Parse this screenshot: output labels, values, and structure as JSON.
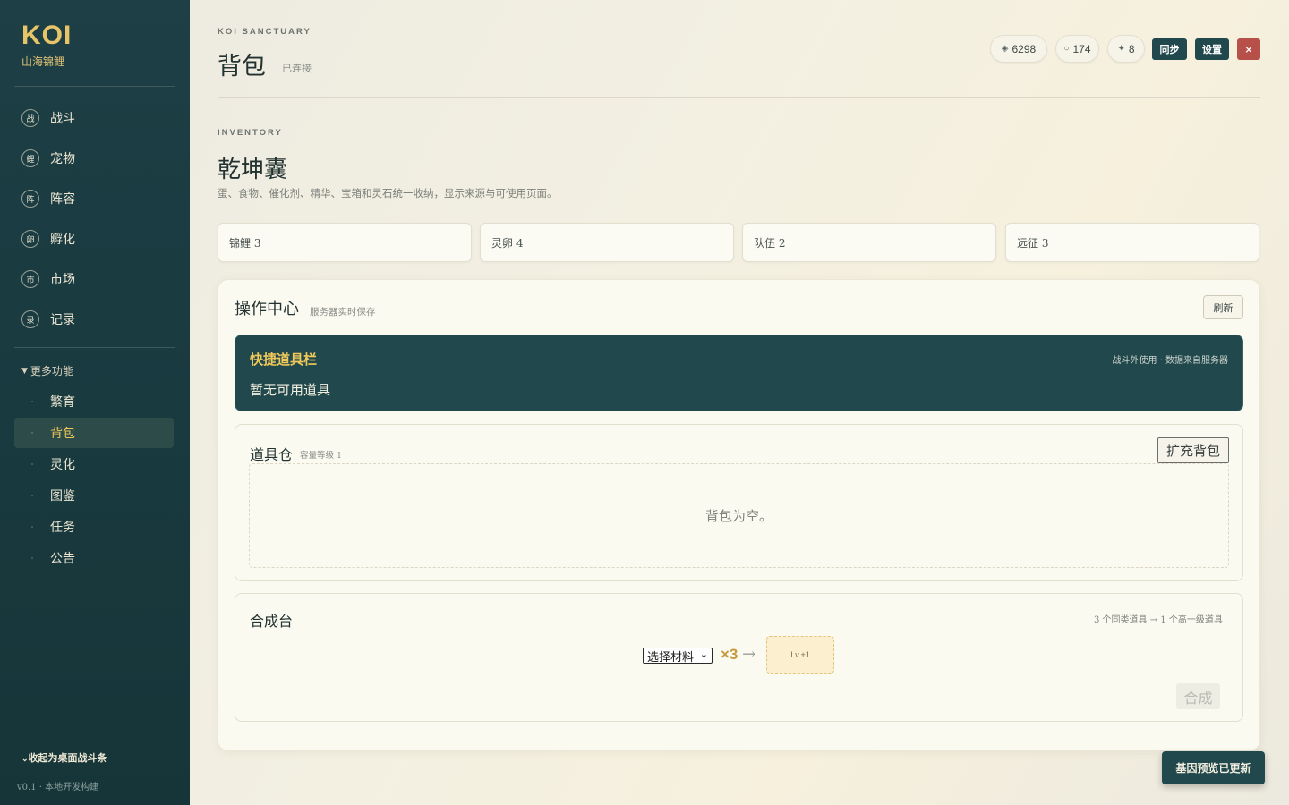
{
  "brand": {
    "logo": "KOI",
    "subtitle": "山海锦鲤"
  },
  "sidebar": {
    "nav": [
      {
        "badge": "战",
        "label": "战斗"
      },
      {
        "badge": "鲤",
        "label": "宠物"
      },
      {
        "badge": "阵",
        "label": "阵容"
      },
      {
        "badge": "卵",
        "label": "孵化"
      },
      {
        "badge": "市",
        "label": "市场"
      },
      {
        "badge": "录",
        "label": "记录"
      }
    ],
    "more_label": "更多功能",
    "more_items": [
      {
        "label": "繁育",
        "active": false
      },
      {
        "label": "背包",
        "active": true
      },
      {
        "label": "灵化",
        "active": false
      },
      {
        "label": "图鉴",
        "active": false
      },
      {
        "label": "任务",
        "active": false
      },
      {
        "label": "公告",
        "active": false
      }
    ],
    "collapse_label": "收起为桌面战斗条",
    "version": "v0.1 · 本地开发构建"
  },
  "header": {
    "eyebrow": "KOI SANCTUARY",
    "title": "背包",
    "status": "已连接",
    "currencies": [
      {
        "icon": "diamond-icon",
        "glyph": "◈",
        "value": "6298"
      },
      {
        "icon": "ring-icon",
        "glyph": "○",
        "value": "174"
      },
      {
        "icon": "sparkle-icon",
        "glyph": "✦",
        "value": "8"
      }
    ],
    "sync_label": "同步",
    "settings_label": "设置",
    "close_label": "×"
  },
  "section": {
    "eyebrow": "INVENTORY",
    "title": "乾坤囊",
    "description": "蛋、食物、催化剂、精华、宝箱和灵石统一收纳，显示来源与可使用页面。",
    "stats": [
      "锦鲤 3",
      "灵卵 4",
      "队伍 2",
      "远征 3"
    ]
  },
  "ops": {
    "title": "操作中心",
    "subtitle": "服务器实时保存",
    "refresh_label": "刷新",
    "quickbar": {
      "title": "快捷道具栏",
      "meta": "战斗外使用 · 数据来自服务器",
      "empty": "暂无可用道具"
    },
    "warehouse": {
      "title": "道具仓",
      "capacity": "容量等级 1",
      "expand_label": "扩充背包",
      "empty": "背包为空。"
    },
    "crafting": {
      "title": "合成台",
      "rule": "3 个同类道具 → 1 个高一级道具",
      "select_value": "选择材料",
      "multiplier": "×3",
      "arrow": "→",
      "result": "Lv.+1",
      "combine_label": "合成"
    }
  },
  "toast": "基因预览已更新",
  "colors": {
    "sidebar_bg": "#1d3f45",
    "accent_gold": "#e8c468",
    "primary_dark": "#21484c",
    "danger": "#b8504a"
  }
}
